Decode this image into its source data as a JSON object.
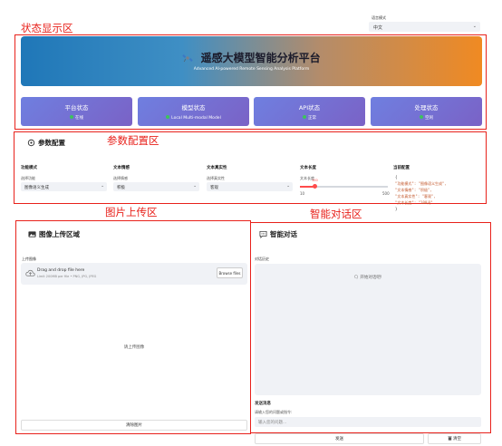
{
  "language": {
    "label": "语言模式",
    "value": "中文"
  },
  "annotations": {
    "status_area": "状态显示区",
    "param_area": "参数配置区",
    "upload_area": "图片上传区",
    "chat_area": "智能对话区"
  },
  "banner": {
    "title": "遥感大模型智能分析平台",
    "subtitle": "Advanced AI-powered Remote Sensing Analysis Platform",
    "icon": "satellite-icon"
  },
  "status_cards": [
    {
      "title": "平台状态",
      "value": "在线"
    },
    {
      "title": "模型状态",
      "value": "Local Multi-modal Model"
    },
    {
      "title": "API状态",
      "value": "正常"
    },
    {
      "title": "处理状态",
      "value": "空闲"
    }
  ],
  "params": {
    "header": "参数配置",
    "function_mode": {
      "title": "功能模式",
      "label": "选择功能",
      "value": "图像语义生成"
    },
    "text_style": {
      "title": "文本情感",
      "label": "选择情感",
      "value": "积极"
    },
    "text_realism": {
      "title": "文本真实性",
      "label": "选择真实性",
      "value": "客观"
    },
    "text_length": {
      "title": "文本长度",
      "label": "文本长度",
      "value": 100,
      "min": 10,
      "max": 500
    },
    "current_config": {
      "title": "当前配置",
      "lines": [
        "{",
        "  \"功能模式\": \"图像语义生成\",",
        "  \"文本情感\": \"积极\",",
        "  \"文本真实性\": \"客观\",",
        "  \"文本长度\": \"100词\"",
        "}"
      ]
    }
  },
  "upload": {
    "header": "图像上传区域",
    "label": "上传图像",
    "dz_main": "Drag and drop file here",
    "dz_sub": "Limit 200MB per file • PNG, JPG, JPEG",
    "browse": "Browse files",
    "placeholder": "请上传图像",
    "clear": "清除图片"
  },
  "chat": {
    "header": "智能对话",
    "history_label": "对话历史",
    "placeholder": "开始对话吧!",
    "send_title": "发送消息",
    "send_label": "请输入您的问题或指令:",
    "input_placeholder": "输入您的问题...",
    "send": "发送",
    "clear": "清空"
  },
  "colors": {
    "annotation": "#e8211b",
    "card_start": "#6f7fe0",
    "card_end": "#7a62c6",
    "status_ok": "#3cc35c",
    "slider": "#ff4b4b"
  }
}
